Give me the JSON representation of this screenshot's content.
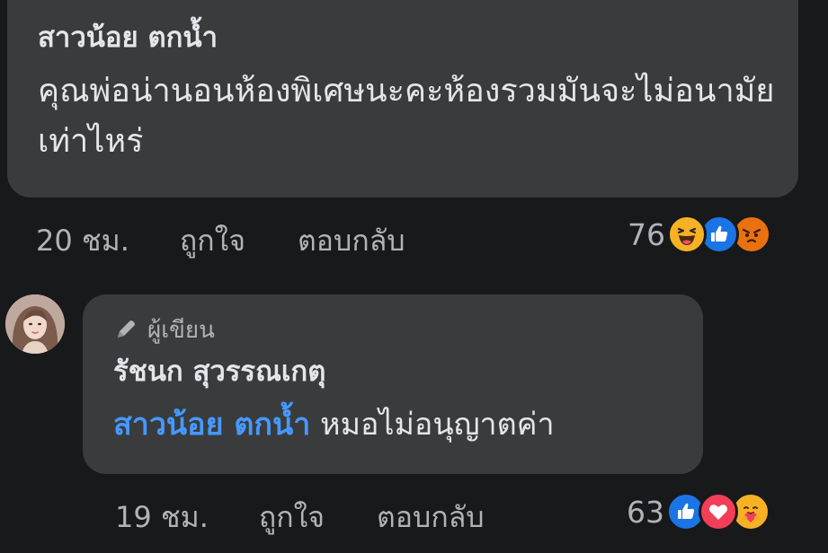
{
  "comment1": {
    "author": "สาวน้อย ตกน้ำ",
    "text": "คุณพ่อน่านอนห้องพิเศษนะคะห้องรวมมันจะไม่อนามัยเท่าไหร่",
    "time": "20 ชม.",
    "like_label": "ถูกใจ",
    "reply_label": "ตอบกลับ",
    "reaction_count": "76",
    "reactions": [
      "haha-icon",
      "like-icon",
      "angry-icon"
    ]
  },
  "comment2": {
    "badge": "ผู้เขียน",
    "author": "รัชนก สุวรรณเกตุ",
    "mention": "สาวน้อย ตกน้ำ",
    "text": "หมอไม่อนุญาตค่า",
    "time": "19 ชม.",
    "like_label": "ถูกใจ",
    "reply_label": "ตอบกลับ",
    "reaction_count": "63",
    "reactions": [
      "like-icon",
      "love-icon",
      "care-icon"
    ]
  },
  "colors": {
    "background": "#18191a",
    "bubble": "#3a3b3c",
    "primary_text": "#e4e6eb",
    "secondary_text": "#b0b3b8",
    "mention": "#4599ff"
  }
}
